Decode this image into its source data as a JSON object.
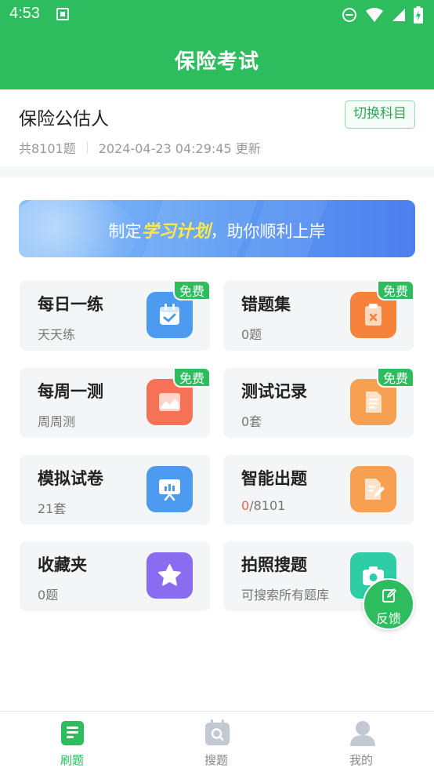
{
  "status_bar": {
    "time": "4:53"
  },
  "app_bar": {
    "title": "保险考试"
  },
  "subject": {
    "name": "保险公估人",
    "switch_label": "切换科目",
    "total": "共8101题",
    "updated": "2024-04-23 04:29:45 更新"
  },
  "banner": {
    "prefix": "制定",
    "highlight": "学习计划",
    "suffix": "，助你顺利上岸"
  },
  "cards": [
    {
      "title": "每日一练",
      "subtitle": "天天练",
      "badge": "免费",
      "icon": "calendar-check-icon",
      "color": "#4c9bf0"
    },
    {
      "title": "错题集",
      "subtitle": "0题",
      "badge": "免费",
      "icon": "wrong-clipboard-icon",
      "color": "#f7823c"
    },
    {
      "title": "每周一测",
      "subtitle": "周周测",
      "badge": "免费",
      "icon": "chart-image-icon",
      "color": "#f67256"
    },
    {
      "title": "测试记录",
      "subtitle": "0套",
      "badge": "免费",
      "icon": "document-lines-icon",
      "color": "#f8a052"
    },
    {
      "title": "模拟试卷",
      "subtitle": "21套",
      "icon": "presentation-board-icon",
      "color": "#4c9bf0"
    },
    {
      "title": "智能出题",
      "subtitle_done": "0",
      "subtitle_total": "/8101",
      "icon": "edit-document-icon",
      "color": "#f8a052"
    },
    {
      "title": "收藏夹",
      "subtitle": "0题",
      "icon": "star-icon",
      "color": "#8a6cf0"
    },
    {
      "title": "拍照搜题",
      "subtitle": "可搜索所有题库",
      "icon": "camera-icon",
      "color": "#2ecda6"
    }
  ],
  "feedback": {
    "label": "反馈"
  },
  "tabs": [
    {
      "label": "刷题",
      "icon": "practice-doc-icon",
      "active": true
    },
    {
      "label": "搜题",
      "icon": "search-calendar-icon",
      "active": false
    },
    {
      "label": "我的",
      "icon": "profile-icon",
      "active": false
    }
  ],
  "colors": {
    "brand": "#2dbd5f",
    "highlight": "#ffe94a",
    "progress_red": "#f0623c"
  }
}
